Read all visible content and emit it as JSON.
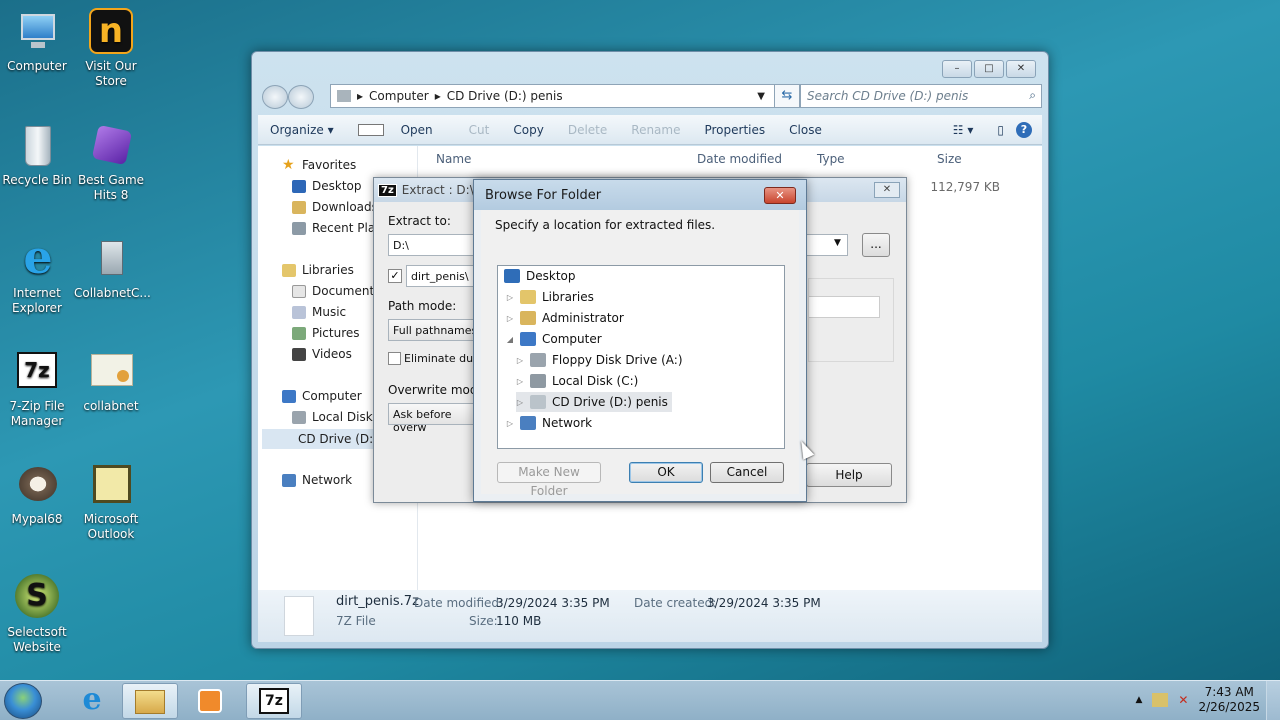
{
  "desktop": {
    "icons": [
      {
        "label": "Computer"
      },
      {
        "label": "Visit Our Store"
      },
      {
        "label": "Recycle Bin"
      },
      {
        "label": "Best Game Hits 8"
      },
      {
        "label": "Internet Explorer"
      },
      {
        "label": "CollabnetC..."
      },
      {
        "label": "7-Zip File Manager"
      },
      {
        "label": "collabnet"
      },
      {
        "label": "Mypal68"
      },
      {
        "label": "Microsoft Outlook"
      },
      {
        "label": "Selectsoft Website"
      }
    ]
  },
  "explorer": {
    "window_buttons": {
      "minimize": "–",
      "maximize": "□",
      "close": "✕"
    },
    "breadcrumb": [
      "Computer",
      "CD Drive (D:) penis"
    ],
    "search_placeholder": "Search CD Drive (D:) penis",
    "toolbar": {
      "organize": "Organize ▾",
      "open": "Open",
      "cut": "Cut",
      "copy": "Copy",
      "delete": "Delete",
      "rename": "Rename",
      "properties": "Properties",
      "close": "Close"
    },
    "nav": {
      "favorites": "Favorites",
      "desktop": "Desktop",
      "downloads": "Downloads",
      "recent_places": "Recent Places",
      "libraries": "Libraries",
      "documents": "Documents",
      "music": "Music",
      "pictures": "Pictures",
      "videos": "Videos",
      "computer": "Computer",
      "local_disk": "Local Disk (C:)",
      "cd_drive": "CD Drive (D:)",
      "network": "Network"
    },
    "columns": {
      "name": "Name",
      "date_modified": "Date modified",
      "type": "Type",
      "size": "Size"
    },
    "file_size_visible": "112,797 KB",
    "details": {
      "filename": "dirt_penis.7z",
      "filetype": "7Z File",
      "date_modified_label": "Date modified:",
      "date_modified": "3/29/2024 3:35 PM",
      "date_created_label": "Date created:",
      "date_created": "3/29/2024 3:35 PM",
      "size_label": "Size:",
      "size": "110 MB"
    }
  },
  "extract_dialog": {
    "title": "Extract : D:\\dirt",
    "extract_to_label": "Extract to:",
    "extract_to_value": "D:\\",
    "subfolder_value": "dirt_penis\\",
    "path_mode_label": "Path mode:",
    "path_mode_value": "Full pathnames",
    "eliminate_label": "Eliminate duplic",
    "overwrite_label": "Overwrite mode:",
    "overwrite_value": "Ask before overw",
    "browse_btn": "...",
    "help_btn": "Help"
  },
  "browse_dialog": {
    "title": "Browse For Folder",
    "description": "Specify a location for extracted files.",
    "tree": [
      {
        "label": "Desktop",
        "level": 0
      },
      {
        "label": "Libraries",
        "level": 1
      },
      {
        "label": "Administrator",
        "level": 1
      },
      {
        "label": "Computer",
        "level": 1
      },
      {
        "label": "Floppy Disk Drive (A:)",
        "level": 2
      },
      {
        "label": "Local Disk (C:)",
        "level": 2
      },
      {
        "label": "CD Drive (D:) penis",
        "level": 2,
        "selected": true
      },
      {
        "label": "Network",
        "level": 1
      }
    ],
    "new_folder_btn": "Make New Folder",
    "ok_btn": "OK",
    "cancel_btn": "Cancel"
  },
  "taskbar": {
    "time": "7:43 AM",
    "date": "2/26/2025",
    "tray_arrow": "▲"
  }
}
